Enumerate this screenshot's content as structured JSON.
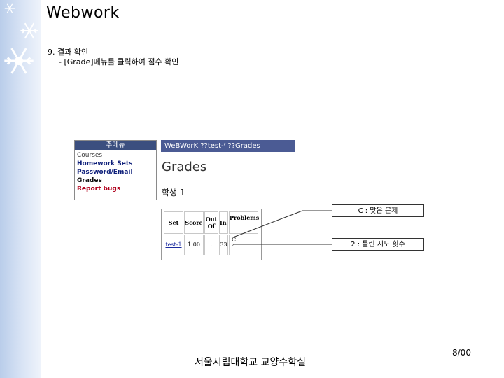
{
  "slide": {
    "title": "Webwork",
    "step": "9. 결과 확인",
    "substep": "- [Grade]메뉴를 클릭하여 점수 확인",
    "footer_org": "서울시립대학교 교양수학실",
    "page_number": "8/00"
  },
  "menu": {
    "header": "주메뉴",
    "items": [
      "Courses",
      "Homework Sets",
      "Password/Email",
      "Grades",
      "Report bugs"
    ]
  },
  "webwork": {
    "breadcrumb": "WeBWorK ??test-ʳ ??Grades",
    "heading": "Grades",
    "student": "학생 1"
  },
  "grades_table": {
    "headers": [
      "Set",
      "Score",
      "Out Of",
      "Ind",
      "Problems"
    ],
    "row": [
      "test-1",
      "1.00",
      ".",
      "33",
      "C\n²"
    ]
  },
  "callouts": {
    "c_label": "C : 맞은 문제",
    "two_label": "2 : 틀린 시도 횟수"
  },
  "colors": {
    "menu_header_bg": "#3b4f7f",
    "breadcrumb_bg": "#4b5b94",
    "side_strip": "#b9cdea"
  }
}
